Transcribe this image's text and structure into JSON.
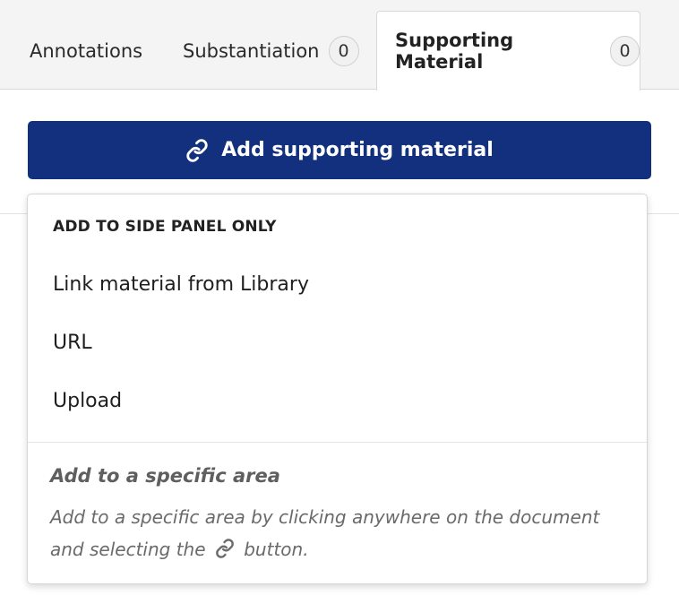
{
  "tabs": [
    {
      "label": "Annotations",
      "count": null
    },
    {
      "label": "Substantiation",
      "count": "0"
    },
    {
      "label": "Supporting Material",
      "count": "0",
      "active": true
    }
  ],
  "add_button": {
    "label": "Add supporting material",
    "icon": "link-icon",
    "color": "#13307f"
  },
  "dropdown": {
    "section_header": "ADD TO SIDE PANEL ONLY",
    "items": [
      "Link material from Library",
      "URL",
      "Upload"
    ],
    "specific": {
      "title": "Add to a specific area",
      "desc_before": "Add to a specific area by clicking anywhere on the document and selecting the",
      "desc_after": "button.",
      "icon": "link-icon"
    }
  }
}
